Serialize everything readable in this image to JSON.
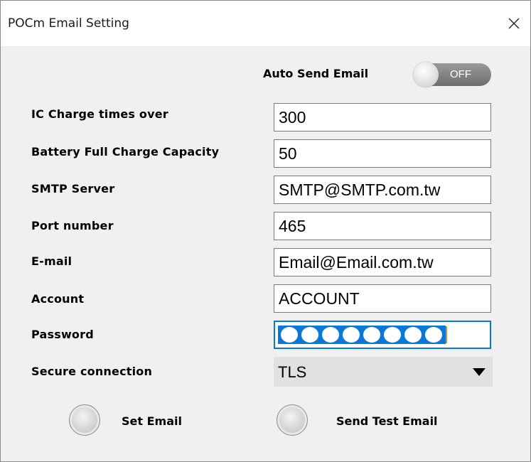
{
  "window": {
    "title": "POCm Email Setting",
    "close_icon": "close-icon"
  },
  "auto_send": {
    "label": "Auto Send Email",
    "state": "OFF"
  },
  "fields": {
    "ic_charge": {
      "label": "IC Charge times over",
      "value": "300"
    },
    "battery_capacity": {
      "label": "Battery Full Charge Capacity",
      "value": "50"
    },
    "smtp_server": {
      "label": "SMTP Server",
      "value": "SMTP@SMTP.com.tw"
    },
    "port": {
      "label": "Port number",
      "value": "465"
    },
    "email": {
      "label": "E-mail",
      "value": "Email@Email.com.tw"
    },
    "account": {
      "label": "Account",
      "value": "ACCOUNT"
    },
    "password": {
      "label": "Password",
      "masked_char_count": 8
    }
  },
  "secure_connection": {
    "label": "Secure connection",
    "selected": "TLS"
  },
  "actions": {
    "set_email": "Set Email",
    "send_test_email": "Send Test Email"
  },
  "colors": {
    "focus_border": "#0a78d7",
    "toggle_off": "#7f7f7f",
    "password_mask": "#0a78d7"
  }
}
